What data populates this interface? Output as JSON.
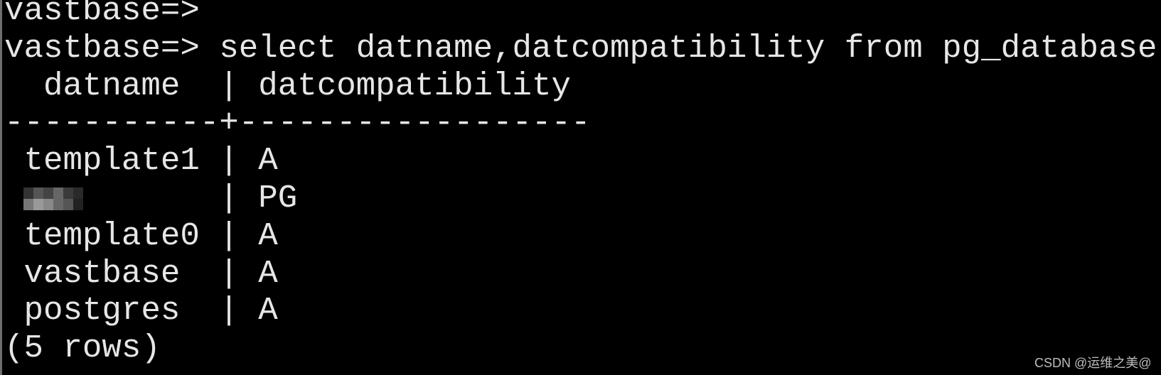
{
  "terminal": {
    "lines": [
      {
        "prompt": "vastbase=>",
        "command": ""
      },
      {
        "prompt": "vastbase=>",
        "command": "select datname,datcompatibility from pg_database;"
      }
    ],
    "table": {
      "headers": [
        "datname",
        "datcompatibility"
      ],
      "separator": "-----------+------------------",
      "rows": [
        {
          "datname": "template1",
          "datcompatibility": "A"
        },
        {
          "datname": "",
          "datcompatibility": "PG",
          "redacted": true
        },
        {
          "datname": "template0",
          "datcompatibility": "A"
        },
        {
          "datname": "vastbase",
          "datcompatibility": "A"
        },
        {
          "datname": "postgres",
          "datcompatibility": "A"
        }
      ],
      "footer": "(5 rows)"
    }
  },
  "watermark": "CSDN @运维之美@",
  "colors": {
    "background": "#000000",
    "text": "#e6e6e6"
  }
}
